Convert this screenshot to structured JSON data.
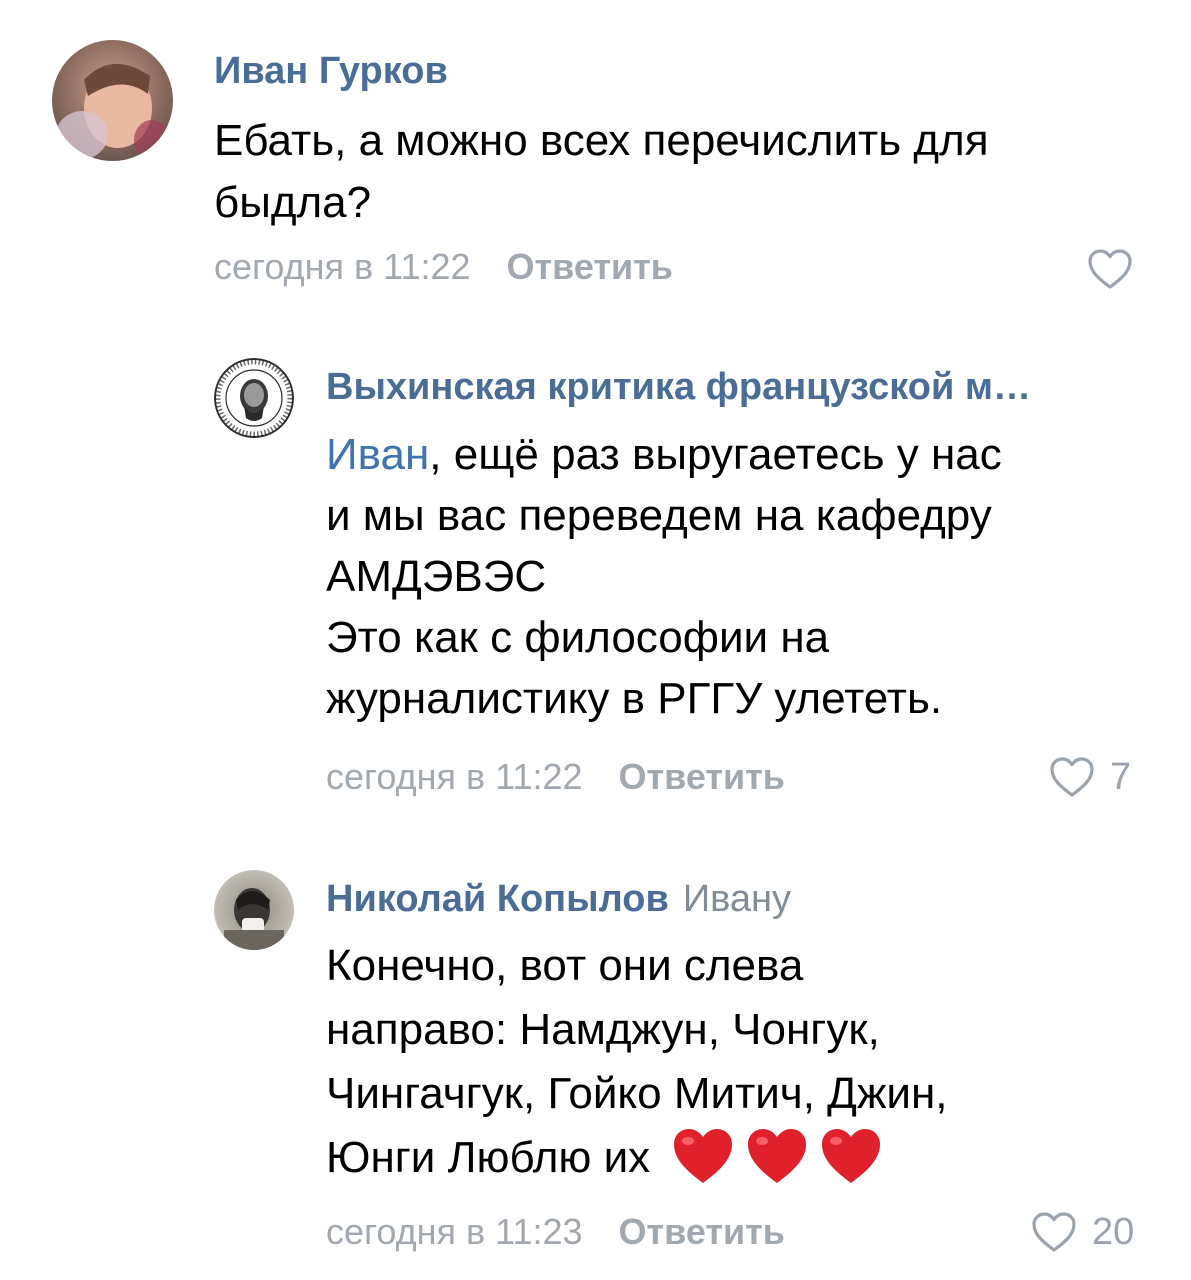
{
  "comments": [
    {
      "author": "Иван Гурков",
      "lines": [
        "Ебать, а можно всех перечислить для",
        "быдла?"
      ],
      "time": "сегодня в 11:22",
      "reply_label": "Ответить",
      "likes": ""
    },
    {
      "author": "Выхинская критика французской м…",
      "mention": "Иван",
      "first_line_rest": ", ещё раз выругаетесь у нас",
      "lines": [
        "и мы вас переведем на кафедру",
        "АМДЭВЭС",
        "Это как с философии на",
        "журналистику в РГГУ улететь."
      ],
      "time": "сегодня в 11:22",
      "reply_label": "Ответить",
      "likes": "7"
    },
    {
      "author": "Николай Копылов",
      "reply_to": "Ивану",
      "lines": [
        "Конечно, вот они слева",
        "направо: Намджун, Чонгук,",
        "Чингачгук, Гойко Митич, Джин,"
      ],
      "last_line": "Юнги Люблю их",
      "emoji_count": 3,
      "time": "сегодня в 11:23",
      "reply_label": "Ответить",
      "likes": "20"
    }
  ],
  "colors": {
    "author": "#4a6d97",
    "mention": "#3f74b0",
    "meta": "#a2a8b0",
    "heart_emoji": "#e0202a"
  }
}
